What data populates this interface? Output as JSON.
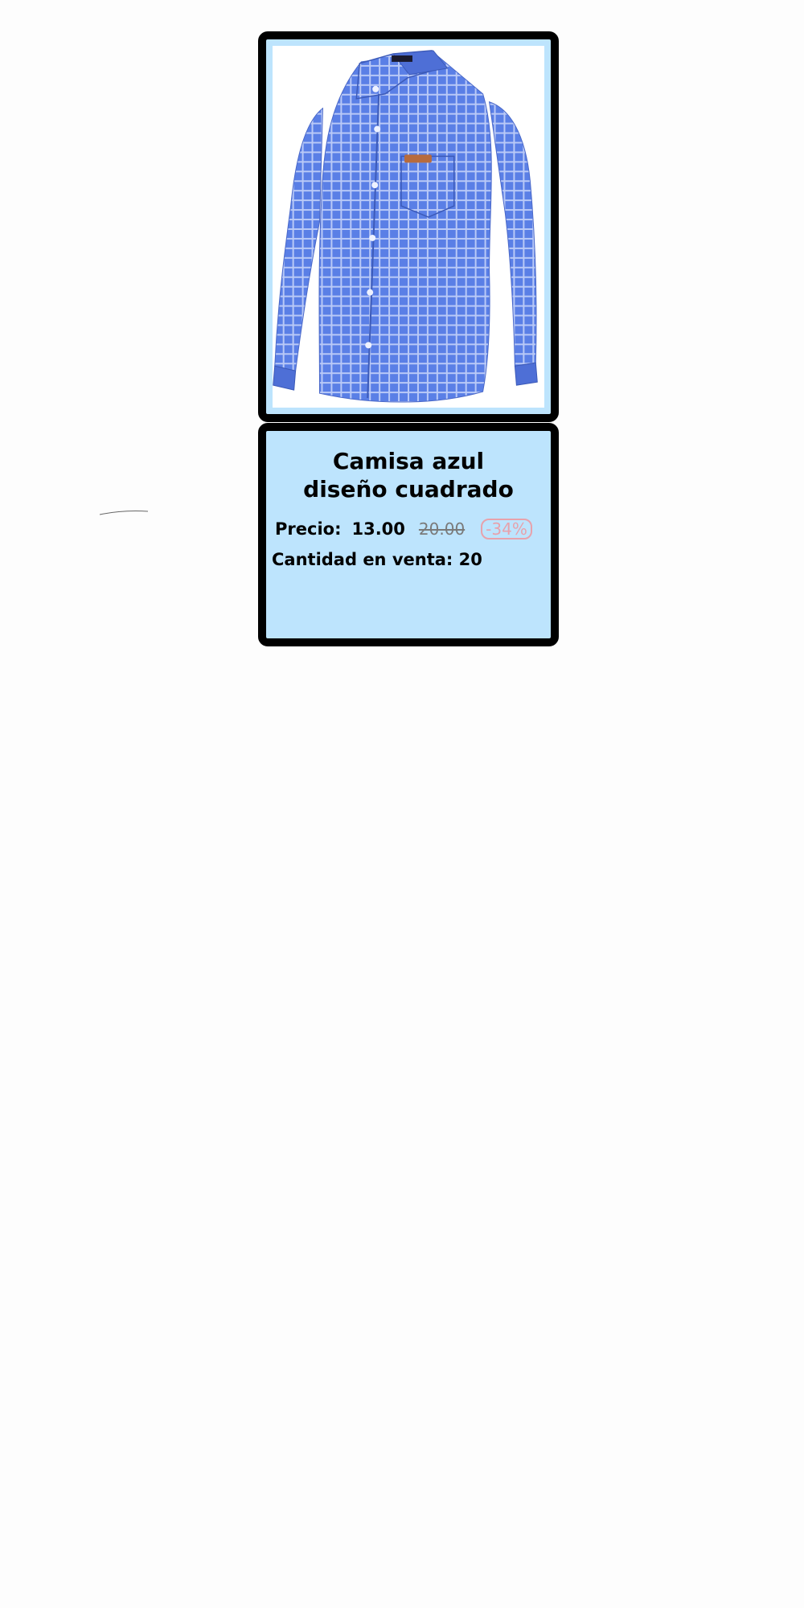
{
  "product": {
    "title_line1": "Camisa azul",
    "title_line2": "diseño cuadrado",
    "image_alt": "Camisa azul de cuadros",
    "price_label": "Precio:",
    "price_current": "13.00",
    "price_original": "20.00",
    "discount": "-34%",
    "quantity_label": "Cantidad en venta:",
    "quantity_value": "20"
  },
  "colors": {
    "card_background": "#bde4fd",
    "card_border": "#000000",
    "shirt_blue": "#5a7fe6",
    "discount_pink": "#e7a2ac",
    "old_price_gray": "#7a7a7a"
  }
}
